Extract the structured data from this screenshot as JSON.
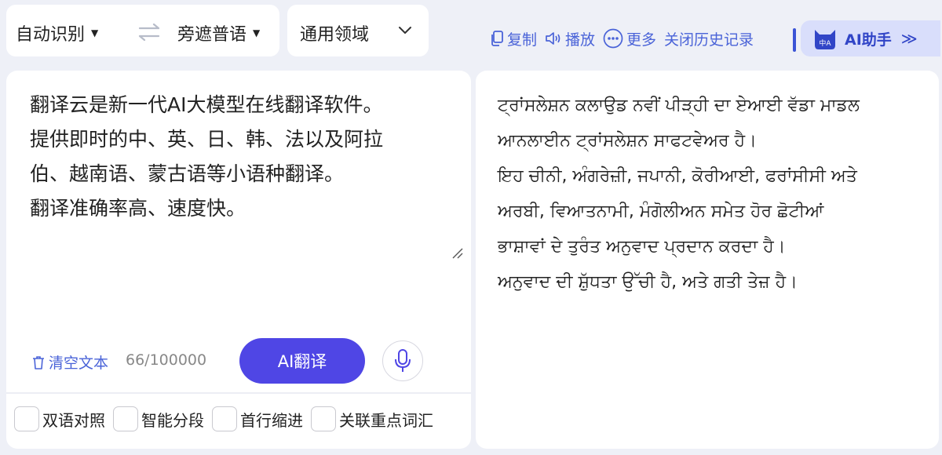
{
  "toolbar": {
    "source_language": "自动识别",
    "target_language": "旁遮普语",
    "domain": "通用领域",
    "copy_label": "复制",
    "play_label": "播放",
    "more_label": "更多",
    "history_label": "关闭历史记录",
    "ai_helper_label": "AI助手",
    "ai_icon_text": "中A"
  },
  "source": {
    "lines": [
      "翻译云是新一代AI大模型在线翻译软件。",
      "提供即时的中、英、日、韩、法以及阿拉",
      "伯、越南语、蒙古语等小语种翻译。",
      "翻译准确率高、速度快。"
    ],
    "clear_label": "清空文本",
    "counter": "66/100000",
    "translate_label": "AI翻译"
  },
  "options": [
    {
      "label": "双语对照",
      "checked": false
    },
    {
      "label": "智能分段",
      "checked": false
    },
    {
      "label": "首行缩进",
      "checked": false
    },
    {
      "label": "关联重点词汇",
      "checked": false
    }
  ],
  "target": {
    "lines": [
      "ਟ੍ਰਾਂਸਲੇਸ਼ਨ ਕਲਾਉਡ ਨਵੀਂ ਪੀੜ੍ਹੀ ਦਾ ਏਆਈ ਵੱਡਾ ਮਾਡਲ",
      "ਆਨਲਾਈਨ ਟ੍ਰਾਂਸਲੇਸ਼ਨ ਸਾਫਟਵੇਅਰ ਹੈ।",
      "ਇਹ ਚੀਨੀ, ਅੰਗਰੇਜ਼ੀ, ਜਪਾਨੀ, ਕੋਰੀਆਈ, ਫਰਾਂਸੀਸੀ ਅਤੇ",
      "ਅਰਬੀ, ਵਿਆਤਨਾਮੀ, ਮੰਗੋਲੀਅਨ ਸਮੇਤ ਹੋਰ ਛੋਟੀਆਂ",
      "ਭਾਸ਼ਾਵਾਂ ਦੇ ਤੁਰੰਤ ਅਨੁਵਾਦ ਪ੍ਰਦਾਨ ਕਰਦਾ ਹੈ।",
      "ਅਨੁਵਾਦ ਦੀ ਸ਼ੁੱਧਤਾ ਉੱਚੀ ਹੈ, ਅਤੇ ਗਤੀ ਤੇਜ਼ ਹੈ।"
    ]
  },
  "colors": {
    "accent": "#4f46e5",
    "link": "#4a63d8",
    "background": "#eef0f7"
  }
}
